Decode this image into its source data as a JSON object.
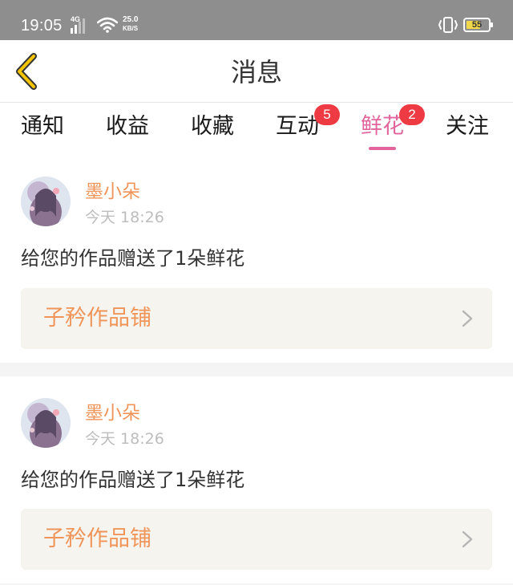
{
  "status_bar": {
    "time": "19:05",
    "network": "4G",
    "speed_value": "25.0",
    "speed_unit": "KB/S",
    "battery_level": "55",
    "icons": [
      "signal-icon",
      "wifi-icon",
      "vibrate-icon",
      "battery-icon"
    ]
  },
  "nav": {
    "title": "消息",
    "back_icon": "chevron-left-icon",
    "accent": "#f5c400"
  },
  "tabs": [
    {
      "label": "通知",
      "badge": null,
      "active": false
    },
    {
      "label": "收益",
      "badge": null,
      "active": false
    },
    {
      "label": "收藏",
      "badge": null,
      "active": false
    },
    {
      "label": "互动",
      "badge": "5",
      "active": false
    },
    {
      "label": "鲜花",
      "badge": "2",
      "active": true
    },
    {
      "label": "关注",
      "badge": null,
      "active": false
    }
  ],
  "colors": {
    "active_tab": "#e2649c",
    "badge": "#ee3b43",
    "sender": "#f0955a",
    "works_text": "#f0955a",
    "works_bg": "#f5f4ee"
  },
  "messages": [
    {
      "sender": "墨小朵",
      "time": "今天 18:26",
      "text": "给您的作品赠送了1朵鲜花",
      "works_name": "子矜作品铺"
    },
    {
      "sender": "墨小朵",
      "time": "今天 18:26",
      "text": "给您的作品赠送了1朵鲜花",
      "works_name": "子矜作品铺"
    }
  ]
}
